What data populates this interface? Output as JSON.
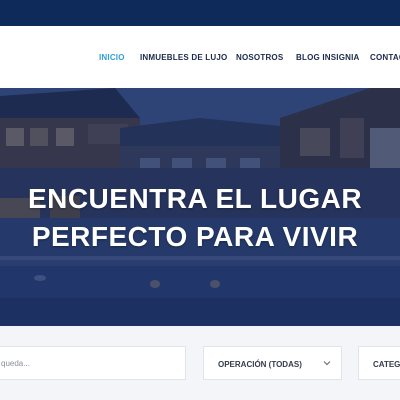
{
  "nav": {
    "items": [
      {
        "label": "INICIO",
        "active": true
      },
      {
        "label": "INMUEBLES DE LUJO",
        "active": false
      },
      {
        "label": "NOSOTROS",
        "active": false
      },
      {
        "label": "BLOG INSIGNIA",
        "active": false
      },
      {
        "label": "CONTAC",
        "active": false
      }
    ]
  },
  "hero": {
    "title_line1": "ENCUENTRA EL LUGAR",
    "title_line2": "PERFECTO PARA VIVIR"
  },
  "search": {
    "keyword_placeholder": "queda...",
    "operation_value": "OPERACIÓN (TODAS)",
    "category_value": "CATEGO"
  },
  "colors": {
    "topbar": "#0d2a5a",
    "nav_active": "#2f9fd8",
    "hero_overlay": "#1f3463"
  }
}
